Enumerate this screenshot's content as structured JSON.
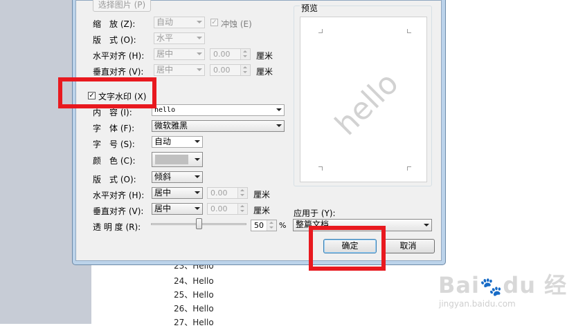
{
  "background_doc": {
    "lines": [
      "23、Hello",
      "24、Hello",
      "25、Hello",
      "26、Hello",
      "27、Hello"
    ]
  },
  "picture": {
    "select_button": "选择图片 (P)",
    "scale_label": "缩　放 (Z):",
    "scale_value": "自动",
    "washout_label": "冲蚀 (E)",
    "layout_label": "版　式 (O):",
    "layout_value": "水平",
    "h_align_label": "水平对齐 (H):",
    "h_align_value": "居中",
    "h_offset": "0.00",
    "h_unit": "厘米",
    "v_align_label": "垂直对齐 (V):",
    "v_align_value": "居中",
    "v_offset": "0.00",
    "v_unit": "厘米"
  },
  "text_watermark": {
    "checkbox_label": "文字水印 (X)",
    "checked": "✓",
    "content_label": "内　容 (I):",
    "content_value": "hello",
    "font_label": "字　体 (F):",
    "font_value": "微软雅黑",
    "size_label": "字　号 (S):",
    "size_value": "自动",
    "color_label": "颜　色 (C):",
    "color_swatch": "#c0c0c0",
    "layout_label": "版　式 (O):",
    "layout_value": "倾斜",
    "h_align_label": "水平对齐 (H):",
    "h_align_value": "居中",
    "h_offset": "0.00",
    "h_unit": "厘米",
    "v_align_label": "垂直对齐 (V):",
    "v_align_value": "居中",
    "v_offset": "0.00",
    "v_unit": "厘米",
    "transparency_label": "透 明 度 (R):",
    "transparency_value": "50",
    "transparency_unit": "%"
  },
  "preview": {
    "label": "预览",
    "watermark_text": "hello"
  },
  "apply_to": {
    "label": "应用于 (Y):",
    "value": "整篇文档"
  },
  "buttons": {
    "ok": "确定",
    "cancel": "取消"
  },
  "baidu_watermark": {
    "logo": "Bai du 经验",
    "url": "jingyan.baidu.com"
  },
  "colors": {
    "highlight_box": "#e8191f"
  }
}
